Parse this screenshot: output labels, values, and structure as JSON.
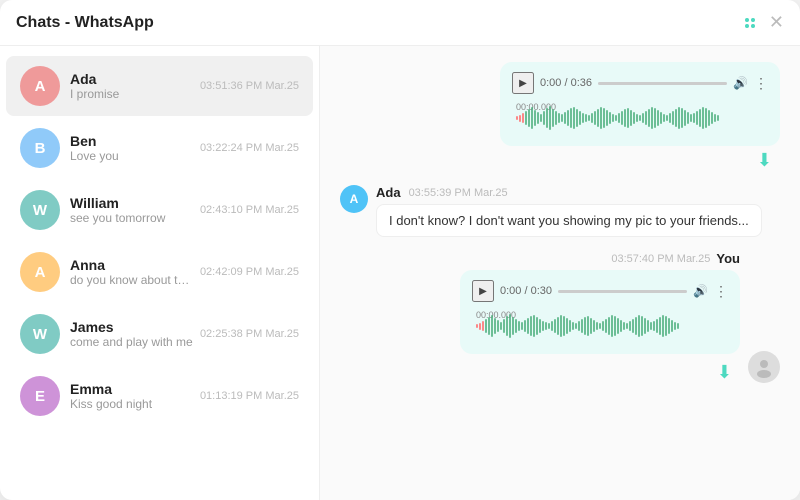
{
  "window": {
    "title": "Chats - WhatsApp"
  },
  "sidebar": {
    "chats": [
      {
        "id": "ada",
        "name": "Ada",
        "preview": "I promise",
        "time": "03:51:36 PM Mar.25",
        "color": "#ef9a9a",
        "letter": "A",
        "active": true
      },
      {
        "id": "ben",
        "name": "Ben",
        "preview": "Love you",
        "time": "03:22:24 PM Mar.25",
        "color": "#90caf9",
        "letter": "B",
        "active": false
      },
      {
        "id": "william",
        "name": "William",
        "preview": "see you tomorrow",
        "time": "02:43:10 PM Mar.25",
        "color": "#80cbc4",
        "letter": "W",
        "active": false
      },
      {
        "id": "anna",
        "name": "Anna",
        "preview": "do you know about that",
        "time": "02:42:09 PM Mar.25",
        "color": "#ffcc80",
        "letter": "A",
        "active": false
      },
      {
        "id": "james",
        "name": "James",
        "preview": "come and play with me",
        "time": "02:25:38 PM Mar.25",
        "color": "#80cbc4",
        "letter": "W",
        "active": false
      },
      {
        "id": "emma",
        "name": "Emma",
        "preview": "Kiss good night",
        "time": "01:13:19 PM Mar.25",
        "color": "#ce93d8",
        "letter": "E",
        "active": false
      }
    ]
  },
  "chat": {
    "messages": [
      {
        "type": "voice-incoming",
        "duration": "0:36",
        "timeDisplay": "0:00 / 0:36"
      },
      {
        "type": "text-incoming",
        "sender": "Ada",
        "timestamp": "03:55:39 PM Mar.25",
        "text": "I don't know? I don't want you showing my pic to your friends...",
        "avatarLetter": "A",
        "avatarColor": "#4fc3f7"
      },
      {
        "type": "voice-outgoing",
        "timestamp": "03:57:40 PM Mar.25",
        "label": "You",
        "duration": "0:30",
        "timeDisplay": "0:00 / 0:30"
      }
    ]
  },
  "icons": {
    "grid": "⠿",
    "close": "✕",
    "play": "▶",
    "volume": "🔊",
    "more": "⋮",
    "download": "⬇"
  }
}
